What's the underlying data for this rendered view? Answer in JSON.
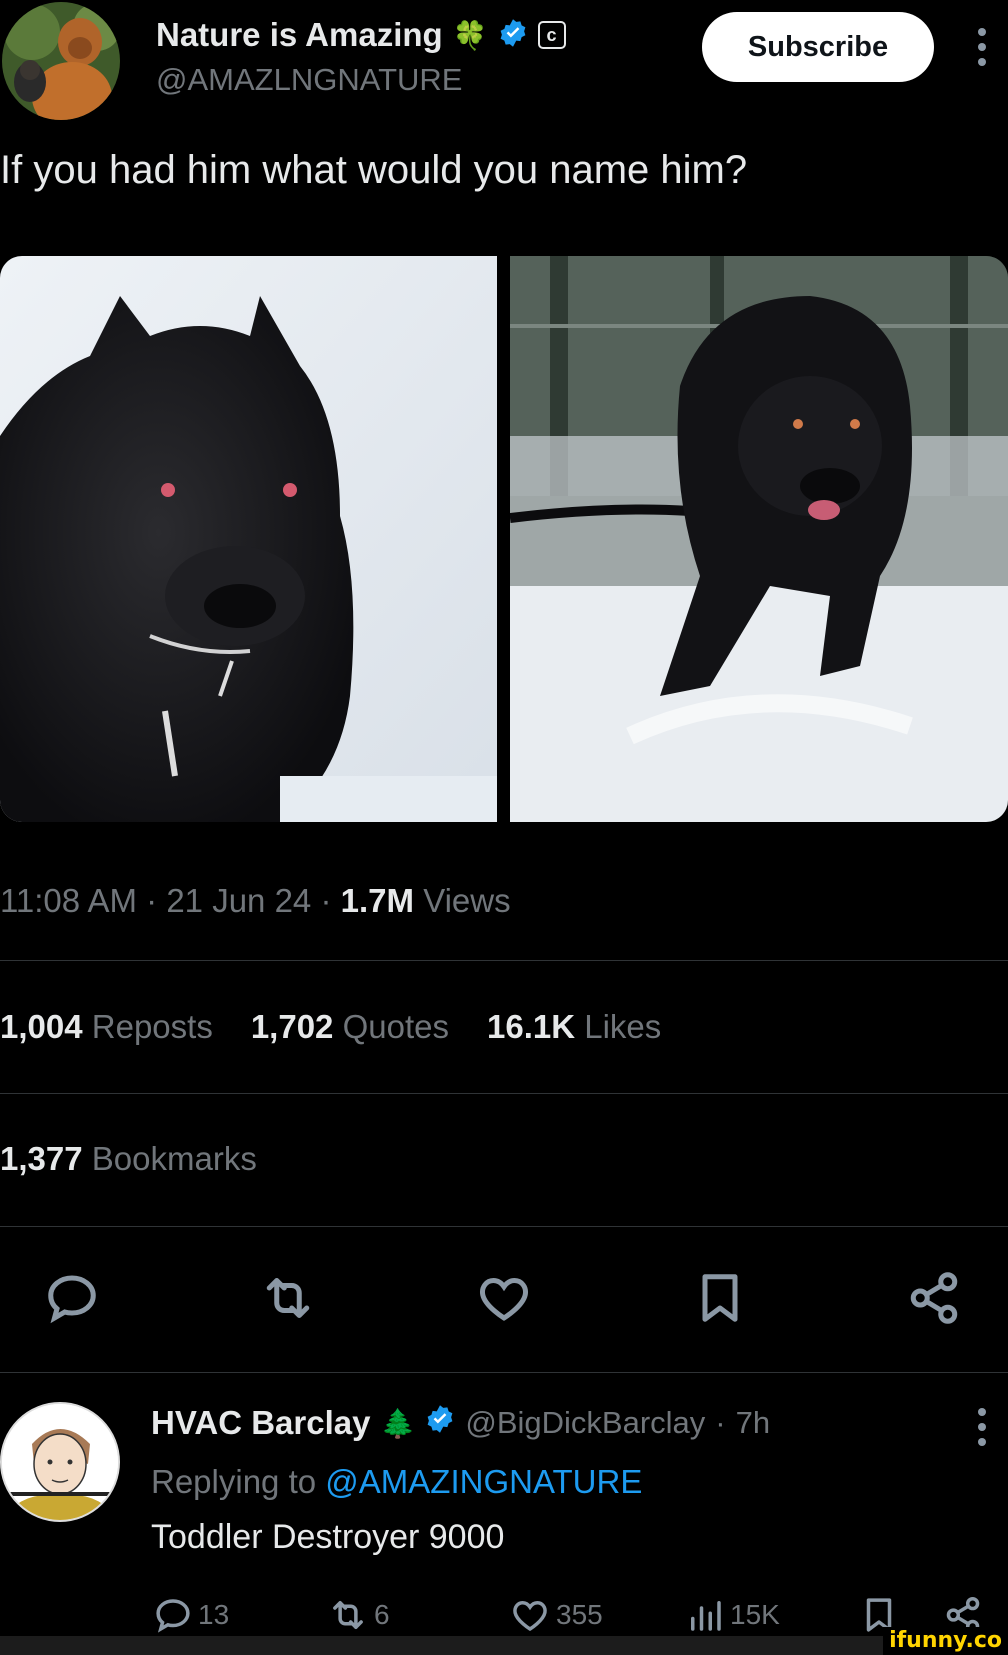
{
  "post": {
    "author_name": "Nature is Amazing",
    "author_emoji": "🍀",
    "author_handle": "@AMAZLNGNATURE",
    "subscribe_label": "Subscribe",
    "text": "If you had him what would you name him?",
    "time": "11:08 AM",
    "date": "21 Jun 24",
    "views_count": "1.7M",
    "views_label": "Views",
    "stats": {
      "reposts_count": "1,004",
      "reposts_label": "Reposts",
      "quotes_count": "1,702",
      "quotes_label": "Quotes",
      "likes_count": "16.1K",
      "likes_label": "Likes",
      "bookmarks_count": "1,377",
      "bookmarks_label": "Bookmarks"
    },
    "actions": [
      "reply-icon",
      "repost-icon",
      "like-icon",
      "bookmark-icon",
      "share-icon"
    ]
  },
  "reply": {
    "author_name": "HVAC Barclay",
    "author_emoji": "🌲",
    "author_handle": "@BigDickBarclay",
    "time": "7h",
    "replying_prefix": "Replying to",
    "replying_handle": "@AMAZINGNATURE",
    "text": "Toddler Destroyer 9000",
    "counts": {
      "replies": "13",
      "reposts": "6",
      "likes": "355",
      "views": "15K"
    }
  },
  "watermark": "ifunny.co",
  "colors": {
    "background": "#000000",
    "text": "#e7e9ea",
    "muted": "#71767b",
    "verified": "#1d9bf0",
    "divider": "#2f3336",
    "watermark": "#ffd400"
  }
}
